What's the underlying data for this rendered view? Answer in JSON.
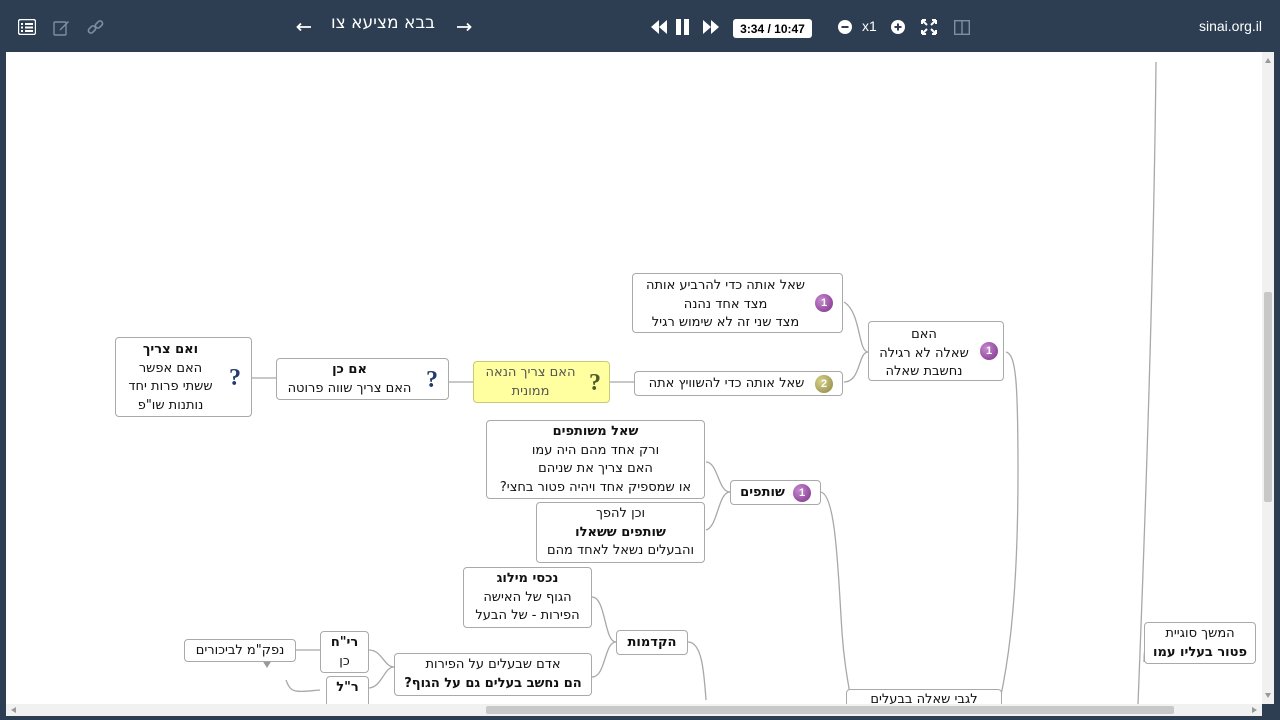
{
  "toolbar": {
    "title": "בבא מציעא צו",
    "time": "3:34 / 10:47",
    "zoom": "x1",
    "site": "sinai.org.il",
    "icons": [
      "list-icon",
      "edit-icon",
      "link-icon",
      "arrow-left-icon",
      "arrow-right-icon",
      "rewind-icon",
      "pause-icon",
      "fast-forward-icon",
      "zoom-out-icon",
      "zoom-in-icon",
      "fullscreen-icon",
      "split-view-icon"
    ]
  },
  "map": {
    "n_ha_im": {
      "lines": [
        "האם",
        "שאלה לא רגילה",
        "נחשבת שאלה"
      ],
      "badge": "1"
    },
    "n_shaal_leharbia": {
      "lines": [
        "שאל אותה כדי להרביע אותה",
        "מצד אחד נהנה",
        "מצד שני זה לא שימוש רגיל"
      ],
      "badge": "1"
    },
    "n_lehashvot": {
      "lines": [
        "שאל אותה כדי להשוויץ אתה"
      ],
      "badge": "2"
    },
    "n_hanaa_mamonit": {
      "lines": [
        "האם צריך הנאה",
        "ממונית"
      ],
      "q": "?"
    },
    "n_im_ken": {
      "lines": [
        "אם כן",
        "האם צריך שווה פרוטה"
      ],
      "q": "?"
    },
    "n_veim_tzarich": {
      "lines": [
        "ואם צריך",
        "האם אפשר",
        "ששתי פרות יחד",
        "נותנות שו\"פ"
      ],
      "q": "?"
    },
    "n_shutafim": {
      "lines": [
        "שותפים"
      ],
      "badge": "1"
    },
    "n_shaal_mishutafim": {
      "lines": [
        "שאל משותפים",
        "ורק אחד מהם היה עמו",
        "האם צריך את שניהם",
        "או שמספיק אחד ויהיה פטור בחצי?"
      ]
    },
    "n_vechen_lehefech": {
      "lines": [
        "וכן להפך",
        "שותפים ששאלו",
        "והבעלים נשאל לאחד מהם"
      ]
    },
    "n_hakdamot": {
      "lines": [
        "הקדמות"
      ]
    },
    "n_nichsei_milog": {
      "lines": [
        "נכסי מילוג",
        "הגוף של האישה",
        "הפירות - של הבעל"
      ]
    },
    "n_adam_sheba": {
      "lines": [
        "אדם שבעלים על הפירות",
        "הם נחשב בעלים גם על הגוף?"
      ]
    },
    "n_rach": {
      "lines": [
        "רי\"ח",
        "כן"
      ]
    },
    "n_rl": {
      "lines": [
        "ר\"ל"
      ]
    },
    "n_nafkam": {
      "lines": [
        "נפק\"מ לביכורים"
      ]
    },
    "n_legabei": {
      "lines": [
        "לגבי שאלה בבעלים"
      ]
    },
    "n_hemshech": {
      "lines": [
        "המשך סוגיית",
        "פטור בעליו עמו"
      ]
    }
  }
}
